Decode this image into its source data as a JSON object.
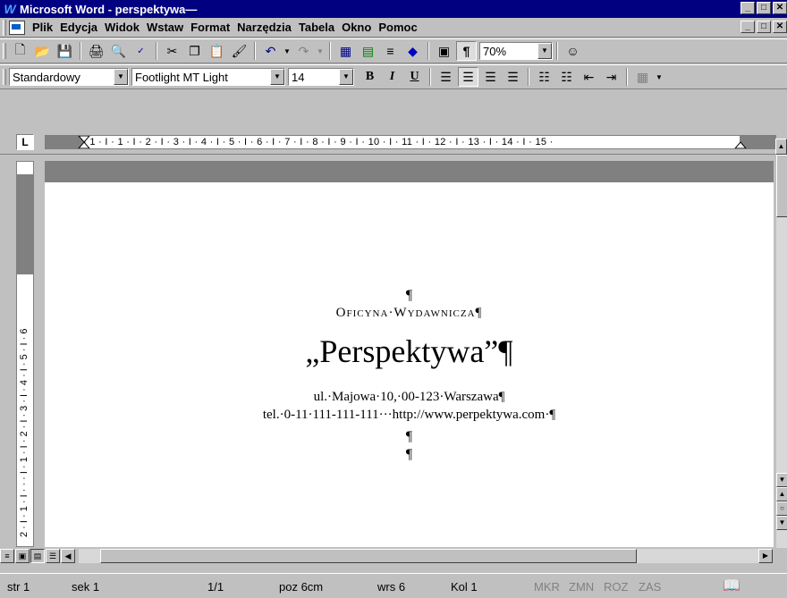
{
  "window": {
    "title": "Microsoft Word - perspektywa—",
    "app_icon": "W"
  },
  "menu": {
    "items": [
      {
        "label": "Plik"
      },
      {
        "label": "Edycja"
      },
      {
        "label": "Widok"
      },
      {
        "label": "Wstaw"
      },
      {
        "label": "Format"
      },
      {
        "label": "Narzędzia"
      },
      {
        "label": "Tabela"
      },
      {
        "label": "Okno"
      },
      {
        "label": "Pomoc"
      }
    ]
  },
  "standard_toolbar": {
    "zoom": "70%"
  },
  "format_toolbar": {
    "style": "Standardowy",
    "font": "Footlight MT Light",
    "size": "14",
    "bold": "B",
    "italic": "I",
    "underline": "U"
  },
  "ruler": {
    "labels": "· 1 · I · 1 · I · 2 · I · 3 · I · 4 · I · 5 · I · 6 · I · 7 · I · 8 · I · 9 · I · 10 · I · 11 · I · 12 · I · 13 · I · 14 · I · 15 ·",
    "vertical_labels": "2 · I · 1 · I · · · I · 1 · I · 2 · I · 3 · I · 4 · I · 5 · I · 6"
  },
  "document": {
    "pilcrow_top": "¶",
    "publisher": "Oficyna·Wydawnicza¶",
    "name": "„Perspektywa”¶",
    "address": "ul.·Majowa·10,·00-123·Warszawa¶",
    "contact": "tel.·0-11·111-111-111···http://www.perpektywa.com·¶",
    "pilcrow_1": "¶",
    "pilcrow_2": "¶"
  },
  "status": {
    "page": "str 1",
    "section": "sek 1",
    "pages": "1/1",
    "position": "poz 6cm",
    "line": "wrs 6",
    "column": "Kol 1",
    "mkr": "MKR",
    "zmn": "ZMN",
    "roz": "ROZ",
    "zas": "ZAS"
  }
}
